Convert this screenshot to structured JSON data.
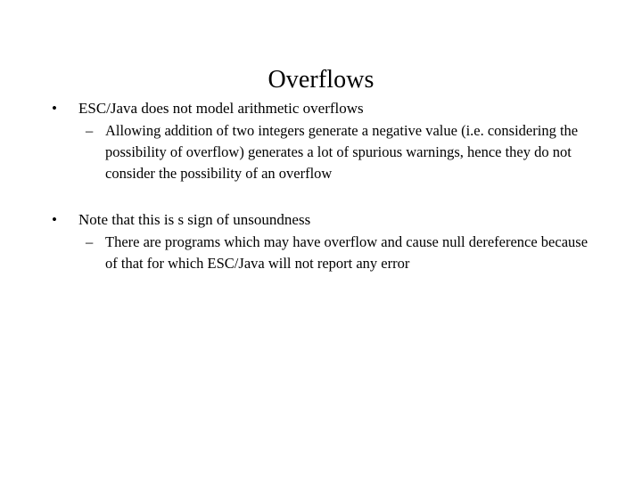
{
  "slide": {
    "title": "Overflows",
    "background_color": "#ffffff",
    "text_color": "#000000",
    "bullet_marker_level1": "•",
    "bullet_marker_level2": "–",
    "groups": [
      {
        "level1": "ESC/Java does not model arithmetic overflows",
        "level2": "Allowing addition of two integers generate a negative value (i.e. considering the possibility of overflow) generates a lot of spurious warnings, hence they do not consider the possibility of an overflow"
      },
      {
        "level1": "Note that this is s sign of unsoundness",
        "level2": "There are programs which may have overflow and cause null dereference because of that for which ESC/Java will not report any error"
      }
    ]
  }
}
